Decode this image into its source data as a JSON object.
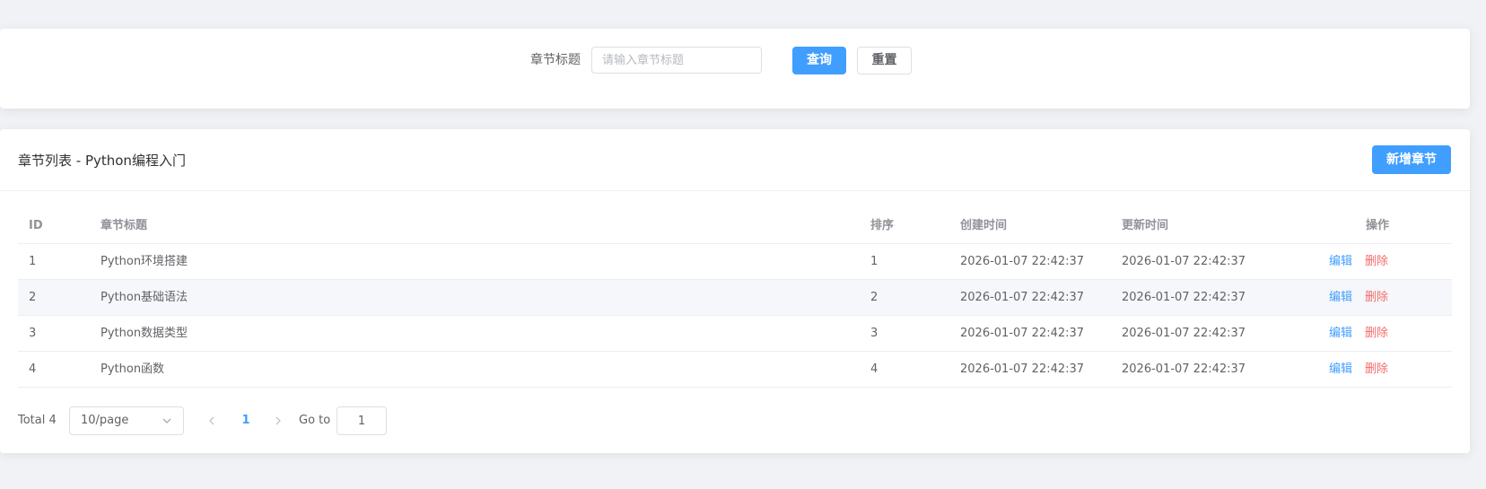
{
  "search": {
    "label": "章节标题",
    "placeholder": "请输入章节标题",
    "query_label": "查询",
    "reset_label": "重置"
  },
  "list": {
    "title": "章节列表 - Python编程入门",
    "add_label": "新增章节",
    "columns": {
      "id": "ID",
      "title": "章节标题",
      "sort": "排序",
      "created": "创建时间",
      "updated": "更新时间",
      "ops": "操作"
    },
    "rows": [
      {
        "id": "1",
        "title": "Python环境搭建",
        "sort": "1",
        "created": "2026-01-07 22:42:37",
        "updated": "2026-01-07 22:42:37",
        "edit": "编辑",
        "delete": "删除"
      },
      {
        "id": "2",
        "title": "Python基础语法",
        "sort": "2",
        "created": "2026-01-07 22:42:37",
        "updated": "2026-01-07 22:42:37",
        "edit": "编辑",
        "delete": "删除"
      },
      {
        "id": "3",
        "title": "Python数据类型",
        "sort": "3",
        "created": "2026-01-07 22:42:37",
        "updated": "2026-01-07 22:42:37",
        "edit": "编辑",
        "delete": "删除"
      },
      {
        "id": "4",
        "title": "Python函数",
        "sort": "4",
        "created": "2026-01-07 22:42:37",
        "updated": "2026-01-07 22:42:37",
        "edit": "编辑",
        "delete": "删除"
      }
    ]
  },
  "pagination": {
    "total": "Total 4",
    "page_size": "10/page",
    "current_page": "1",
    "goto_label": "Go to",
    "goto_value": "1"
  },
  "colors": {
    "primary": "#409eff",
    "danger": "#f56c6c",
    "background": "#f0f2f5"
  },
  "icons": {
    "prev": "chevron-left-icon",
    "next": "chevron-right-icon",
    "dropdown": "chevron-down-icon"
  }
}
